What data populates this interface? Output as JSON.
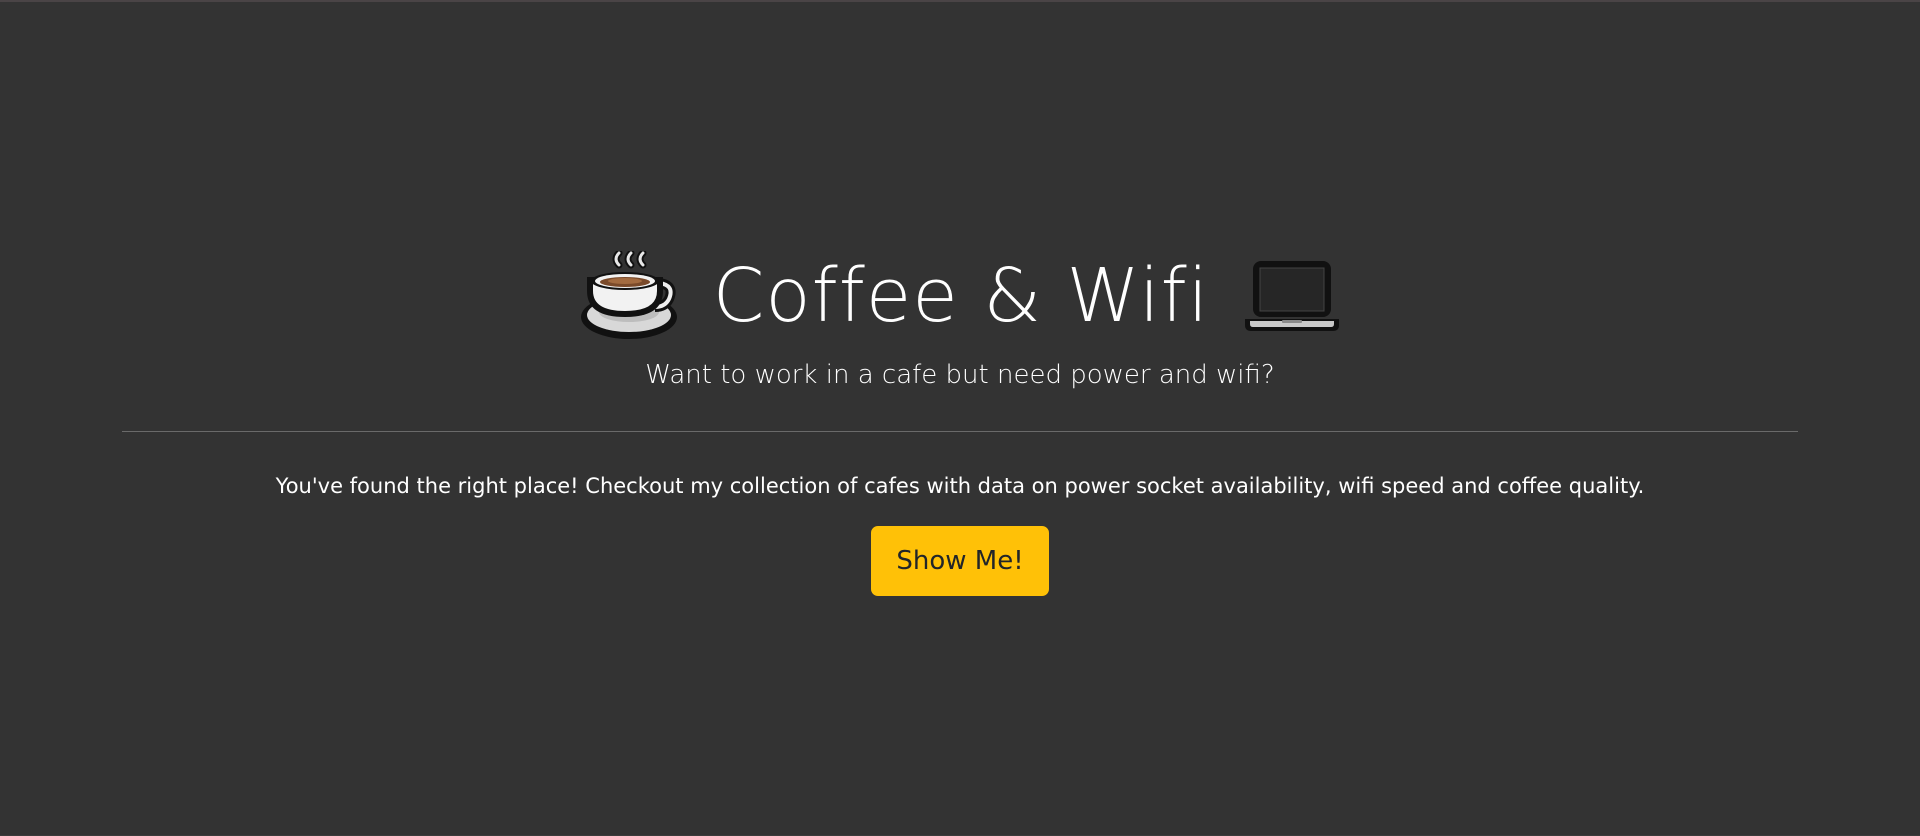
{
  "header": {
    "title": "Coffee & Wifi",
    "subtitle": "Want to work in a cafe but need power and wifi?",
    "left_icon": "coffee-cup-icon",
    "right_icon": "laptop-icon"
  },
  "main": {
    "description": "You've found the right place! Checkout my collection of cafes with data on power socket availability, wifi speed and coffee quality.",
    "button_label": "Show Me!"
  },
  "colors": {
    "background": "#333333",
    "text": "#ffffff",
    "button_bg": "#ffc107",
    "button_text": "#212529",
    "divider": "#6a6a6a"
  }
}
